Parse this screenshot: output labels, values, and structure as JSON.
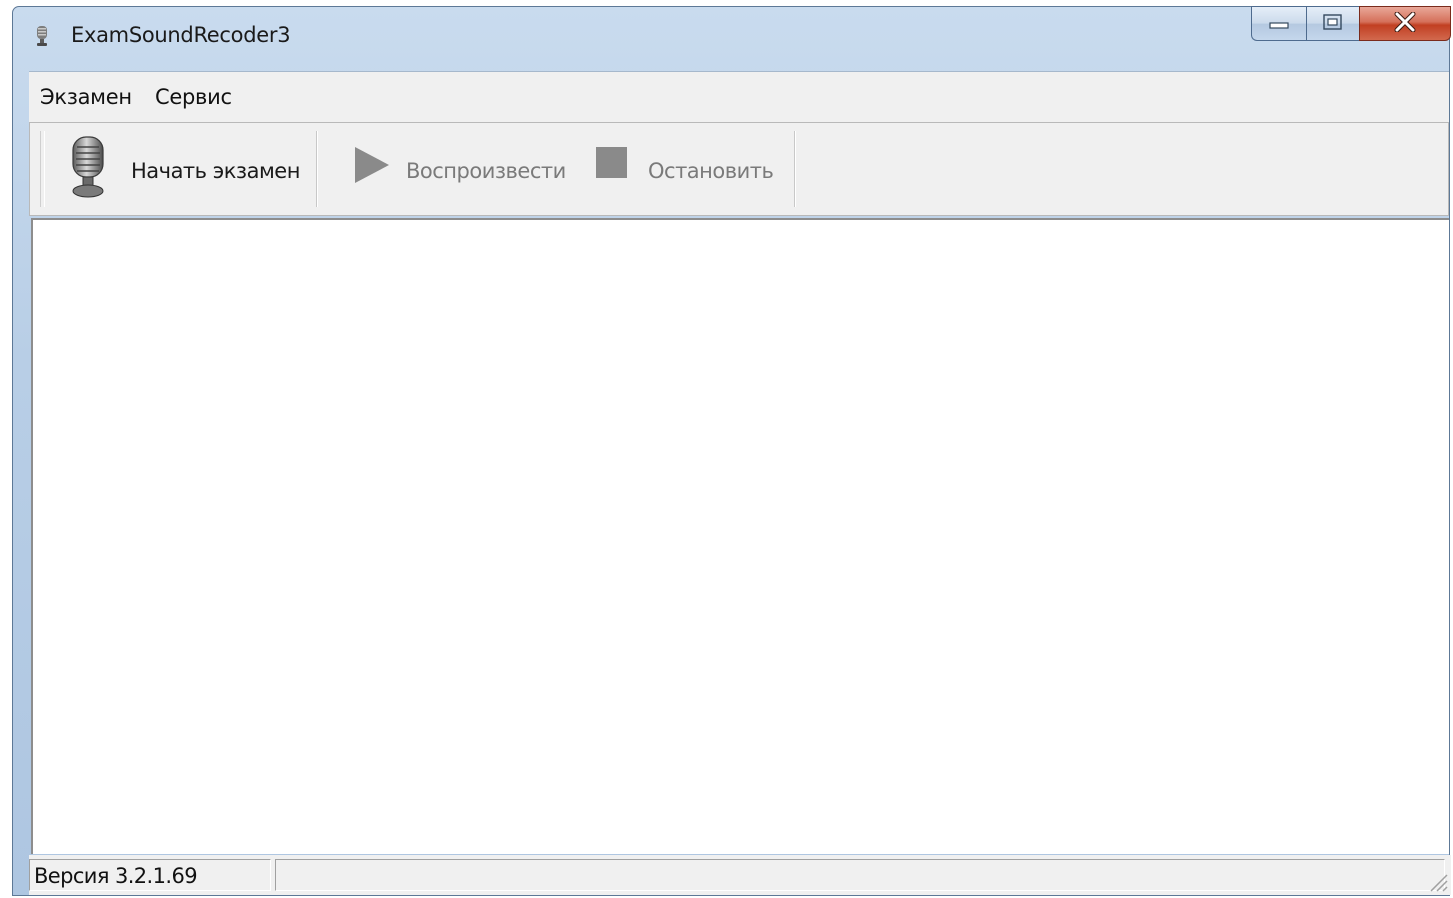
{
  "window": {
    "title": "ExamSoundRecoder3",
    "app_icon": "microphone-icon",
    "caption_buttons": {
      "minimize_icon": "minimize-icon",
      "maximize_icon": "restore-icon",
      "close_icon": "close-icon"
    }
  },
  "menubar": {
    "items": [
      {
        "label": "Экзамен"
      },
      {
        "label": "Сервис"
      }
    ]
  },
  "toolbar": {
    "start": {
      "label": "Начать экзамен",
      "icon": "microphone-icon",
      "enabled": true
    },
    "play": {
      "label": "Воспроизвести",
      "icon": "play-icon",
      "enabled": false
    },
    "stop": {
      "label": "Остановить",
      "icon": "stop-icon",
      "enabled": false
    }
  },
  "statusbar": {
    "version": "Версия 3.2.1.69",
    "message": ""
  },
  "colors": {
    "title_bar": "#b8cee6",
    "close_button": "#c13f22",
    "disabled_icon": "#8a8a8a",
    "face": "#f0f0f0"
  }
}
